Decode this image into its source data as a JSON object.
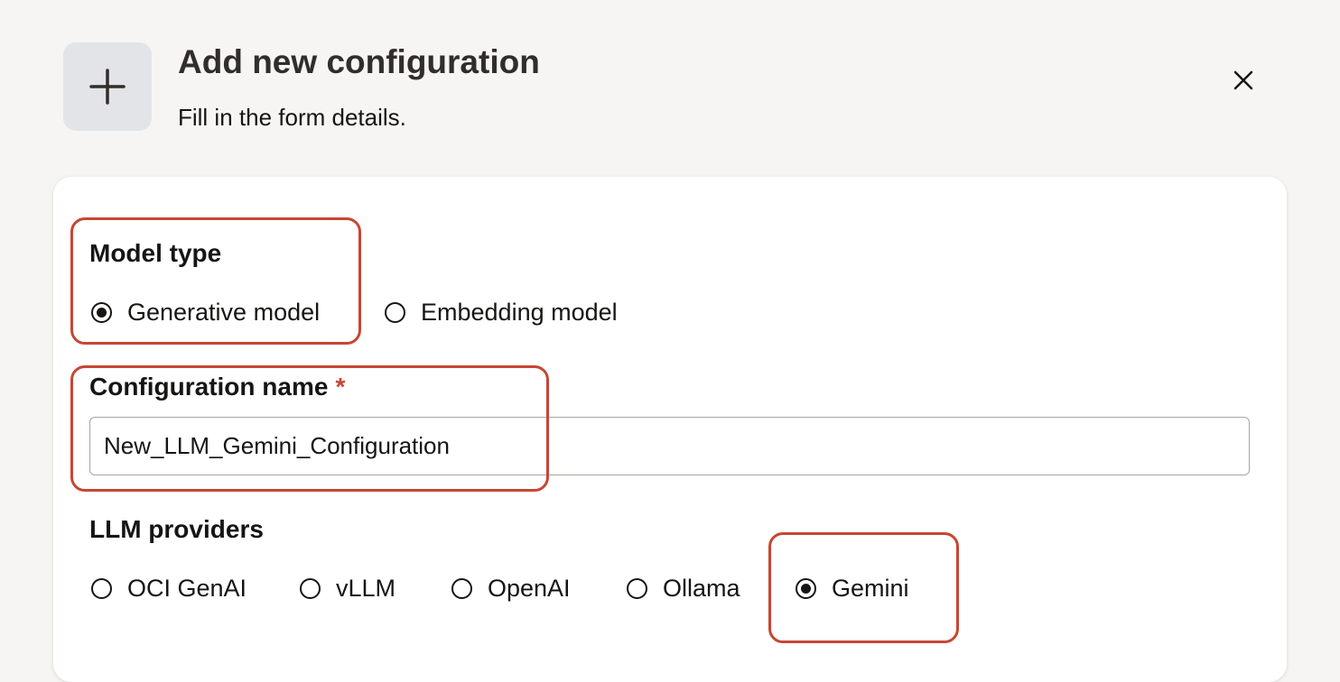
{
  "header": {
    "icon": "plus-icon",
    "title": "Add new configuration",
    "subtitle": "Fill in the form details.",
    "close_icon": "close-icon"
  },
  "form": {
    "model_type": {
      "label": "Model type",
      "options": [
        {
          "label": "Generative model",
          "selected": true
        },
        {
          "label": "Embedding model",
          "selected": false
        }
      ]
    },
    "configuration_name": {
      "label": "Configuration name",
      "required_marker": "*",
      "value": "New_LLM_Gemini_Configuration"
    },
    "llm_providers": {
      "label": "LLM providers",
      "options": [
        {
          "label": "OCI GenAI",
          "selected": false
        },
        {
          "label": "vLLM",
          "selected": false
        },
        {
          "label": "OpenAI",
          "selected": false
        },
        {
          "label": "Ollama",
          "selected": false
        },
        {
          "label": "Gemini",
          "selected": true
        }
      ]
    }
  },
  "colors": {
    "background": "#f6f5f3",
    "highlight": "#c74634",
    "required": "#c74634",
    "icon_tile": "#e3e4e8"
  }
}
